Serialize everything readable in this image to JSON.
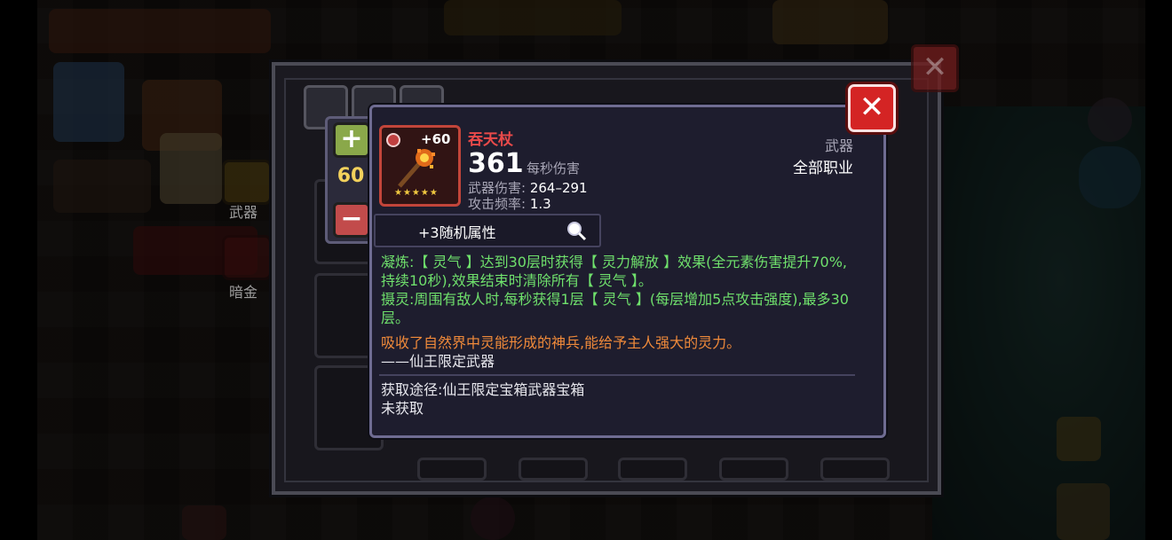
{
  "background": {
    "label_weapon": "武器",
    "label_darkgold": "暗金"
  },
  "adjuster": {
    "level": "60",
    "plus_icon": "plus-icon",
    "minus_icon": "minus-icon"
  },
  "item": {
    "name": "吞天杖",
    "enhance": "+60",
    "dps": "361",
    "dps_label": "每秒伤害",
    "weapon_damage_label": "武器伤害:",
    "weapon_damage": "264–291",
    "attack_rate_label": "攻击频率:",
    "attack_rate": "1.3",
    "type": "武器",
    "class": "全部职业",
    "stars": 5,
    "random_attrs": "+3随机属性",
    "skill1": "凝炼:【 灵气 】达到30层时获得【 灵力解放 】效果(全元素伤害提升70%,持续10秒),效果结束时清除所有【 灵气 】。",
    "skill2": "摄灵:周围有敌人时,每秒获得1层【 灵气 】(每层增加5点攻击强度),最多30层。",
    "lore": "吸收了自然界中灵能形成的神兵,能给予主人强大的灵力。",
    "lore_source": "——仙王限定武器",
    "obtain": "获取途径:仙王限定宝箱武器宝箱",
    "status": "未获取"
  },
  "colors": {
    "name": "#e94a4a",
    "skill_text": "#6fe06c",
    "lore_text": "#f08a3a",
    "close_button": "#d42424"
  }
}
